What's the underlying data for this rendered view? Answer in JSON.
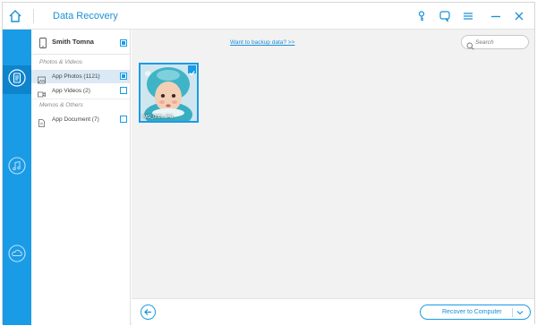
{
  "app": {
    "title": "Data Recovery"
  },
  "titlebar": {
    "icons": [
      "home-icon",
      "key-icon",
      "feedback-icon",
      "menu-icon",
      "minimize-icon",
      "close-icon"
    ]
  },
  "rail": {
    "items": [
      {
        "icon": "device-recover-icon",
        "active": true
      },
      {
        "icon": "itunes-recover-icon",
        "active": false
      },
      {
        "icon": "icloud-recover-icon",
        "active": false
      }
    ]
  },
  "sources": {
    "device_name": "Smith Tomna",
    "categories": [
      {
        "label": "Photos & Videos",
        "items": [
          {
            "label": "App Photos (1121)",
            "icon": "photo-icon",
            "checked": true,
            "selected": true
          },
          {
            "label": "App Videos (2)",
            "icon": "video-icon",
            "checked": false,
            "selected": false
          }
        ]
      },
      {
        "label": "Memos & Others",
        "items": [
          {
            "label": "App Document (7)",
            "icon": "document-icon",
            "checked": false,
            "selected": false
          }
        ]
      }
    ]
  },
  "main": {
    "backup_link": "Want to backup data? >>",
    "search_placeholder": "Search",
    "thumbnail": {
      "name": "IMG_0001.JPG",
      "checked": true
    }
  },
  "bottom": {
    "recover_label": "Recover to Computer"
  },
  "colors": {
    "accent": "#1a9be6",
    "rail_active": "#0d84cc",
    "selected_row": "#dbe9f5",
    "main_bg": "#f2f2f2"
  }
}
